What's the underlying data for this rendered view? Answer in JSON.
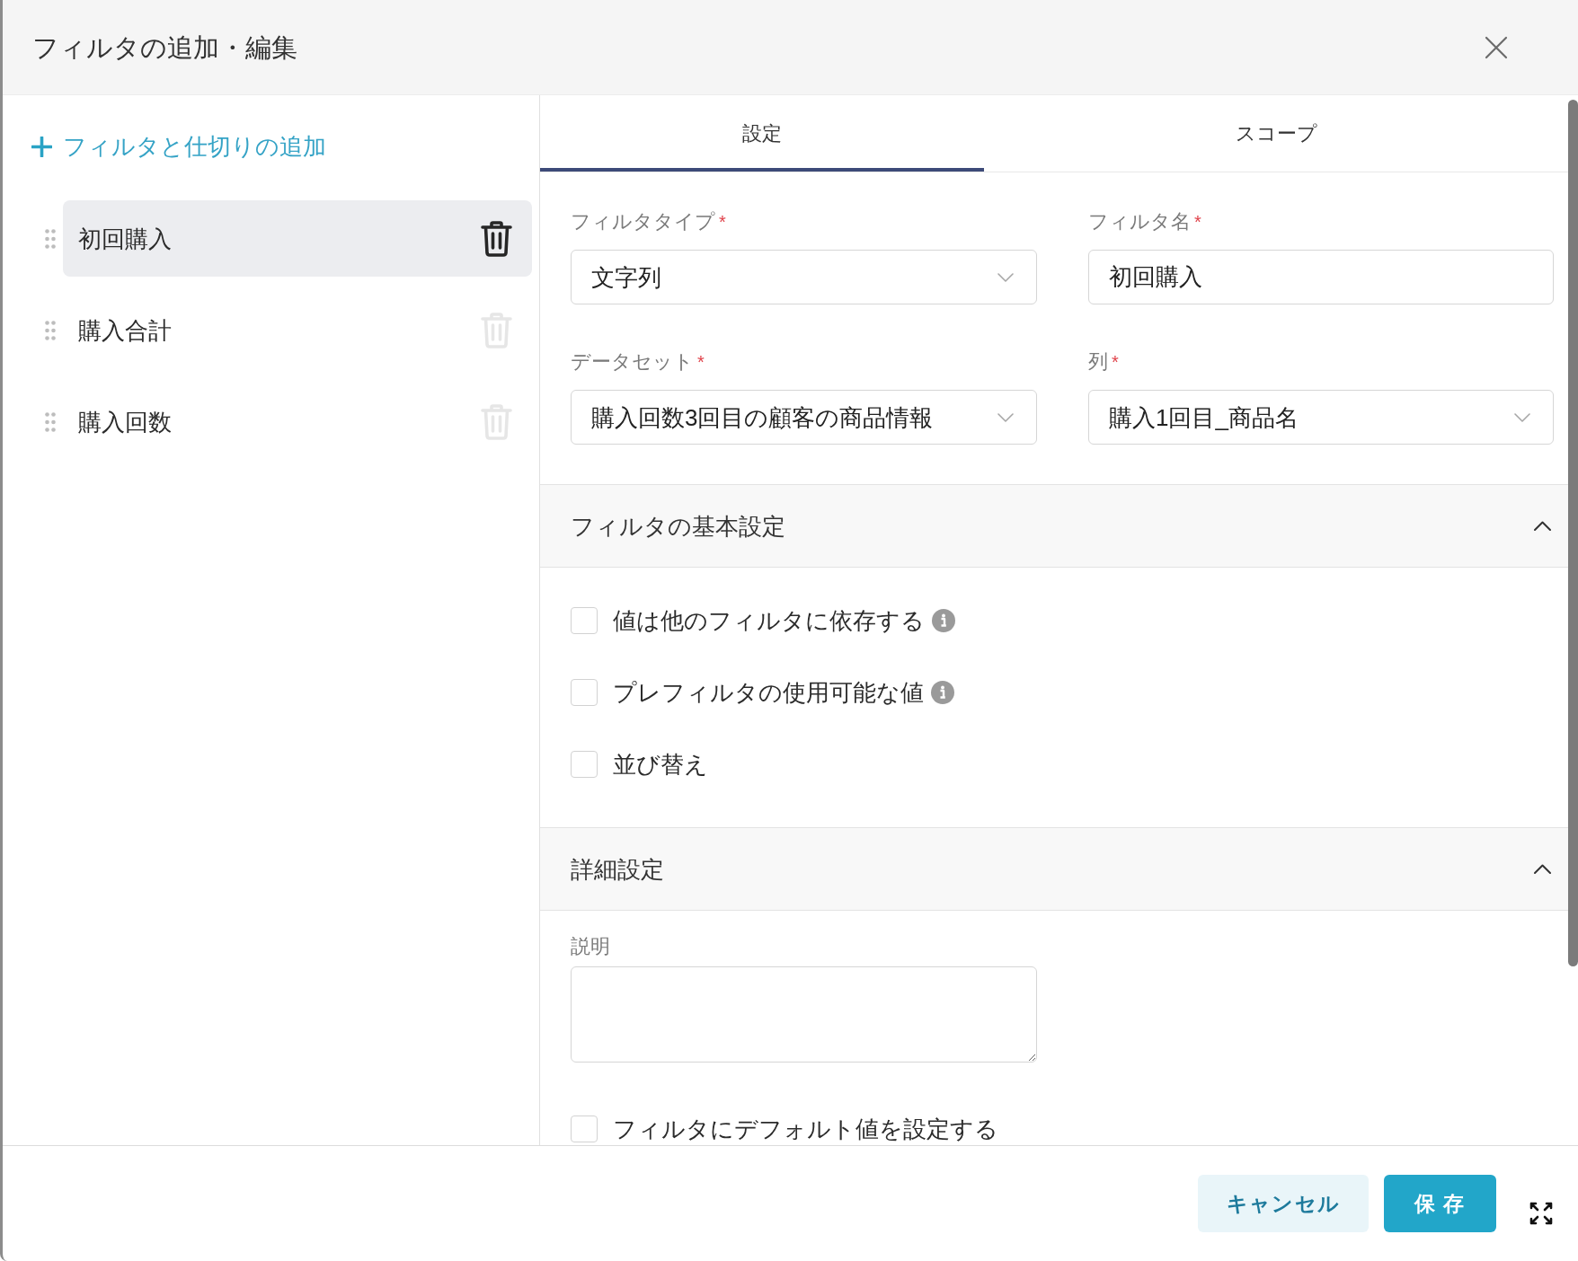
{
  "window": {
    "title": "フィルタの追加・編集"
  },
  "sidebar": {
    "add_link": "フィルタと仕切りの追加",
    "filters": [
      {
        "label": "初回購入",
        "selected": true
      },
      {
        "label": "購入合計",
        "selected": false
      },
      {
        "label": "購入回数",
        "selected": false
      }
    ]
  },
  "tabs": [
    {
      "label": "設定",
      "selected": true
    },
    {
      "label": "スコープ",
      "selected": false
    }
  ],
  "fields": [
    {
      "kind": "select",
      "label": "フィルタタイプ",
      "required_mark": "*",
      "value": "文字列"
    },
    {
      "kind": "text",
      "label": "フィルタ名",
      "required_mark": "*",
      "value": "初回購入"
    },
    {
      "kind": "select",
      "label": "データセット",
      "required_mark": "*",
      "value": "購入回数3回目の顧客の商品情報"
    },
    {
      "kind": "select",
      "label": "列",
      "required_mark": "*",
      "value": "購入1回目_商品名"
    }
  ],
  "sections": [
    {
      "title": "フィルタの基本設定",
      "expanded": true,
      "items": [
        {
          "kind": "checkbox",
          "label": "値は他のフィルタに依存する",
          "checked": false,
          "info": true
        },
        {
          "kind": "checkbox",
          "label": "プレフィルタの使用可能な値",
          "checked": false,
          "info": true
        },
        {
          "kind": "checkbox",
          "label": "並び替え",
          "checked": false,
          "info": false
        }
      ]
    },
    {
      "title": "詳細設定",
      "expanded": true,
      "items": [
        {
          "kind": "textarea",
          "label": "説明"
        },
        {
          "kind": "checkbox",
          "label": "フィルタにデフォルト値を設定する",
          "checked": false,
          "info": false
        }
      ]
    }
  ],
  "footer": {
    "buttons": [
      {
        "kind": "secondary",
        "label": "キャンセル"
      },
      {
        "kind": "primary",
        "label": "保 存"
      }
    ]
  }
}
